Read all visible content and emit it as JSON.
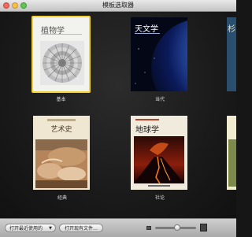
{
  "window": {
    "title": "模板选取器"
  },
  "templates": [
    {
      "label": "基本",
      "cover_title": "植物学",
      "selected": true
    },
    {
      "label": "当代",
      "cover_title": "天文学",
      "selected": false
    },
    {
      "label": "",
      "cover_title": "杉",
      "selected": false
    },
    {
      "label": "经典",
      "cover_title": "艺术史",
      "selected": false
    },
    {
      "label": "社论",
      "cover_title": "地球学",
      "selected": false
    }
  ],
  "bottombar": {
    "open_recent_label": "打开最近使用的",
    "open_existing_label": "打开现有文件…",
    "zoom_level": 0.55
  },
  "colors": {
    "selection": "#f2d22e",
    "window_bg": "#161616"
  }
}
